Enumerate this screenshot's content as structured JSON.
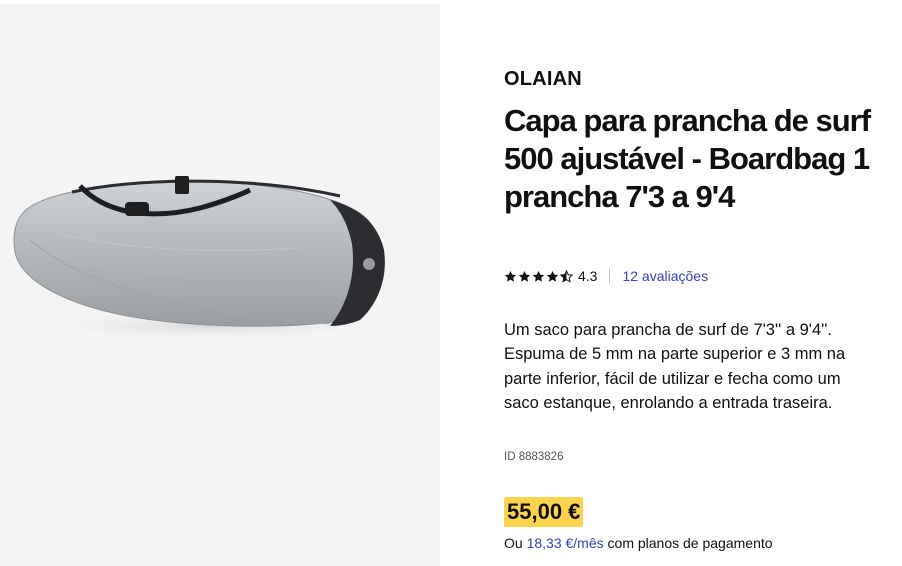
{
  "product": {
    "brand": "OLAIAN",
    "title": "Capa para prancha de surf 500 ajustável - Boardbag 1 prancha 7'3 a 9'4",
    "rating": {
      "value": "4.3",
      "stars": 4.5,
      "reviews_label": "12 avaliações"
    },
    "description": "Um saco para prancha de surf de 7'3'' a 9'4''. Espuma de 5 mm na parte superior e 3 mm na parte inferior, fácil de utilizar e fecha como um saco estanque, enrolando a entrada traseira.",
    "id_label": "ID 8883826",
    "price": "55,00 €",
    "installment": {
      "prefix": "Ou",
      "amount": "18,33 €/mês",
      "suffix": "com planos de pagamento"
    }
  },
  "colors": {
    "accent_link": "#3643ba",
    "price_highlight": "#fcd34d",
    "image_background": "#f4f4f4"
  },
  "icons": [
    "star-icon",
    "half-star-icon"
  ]
}
